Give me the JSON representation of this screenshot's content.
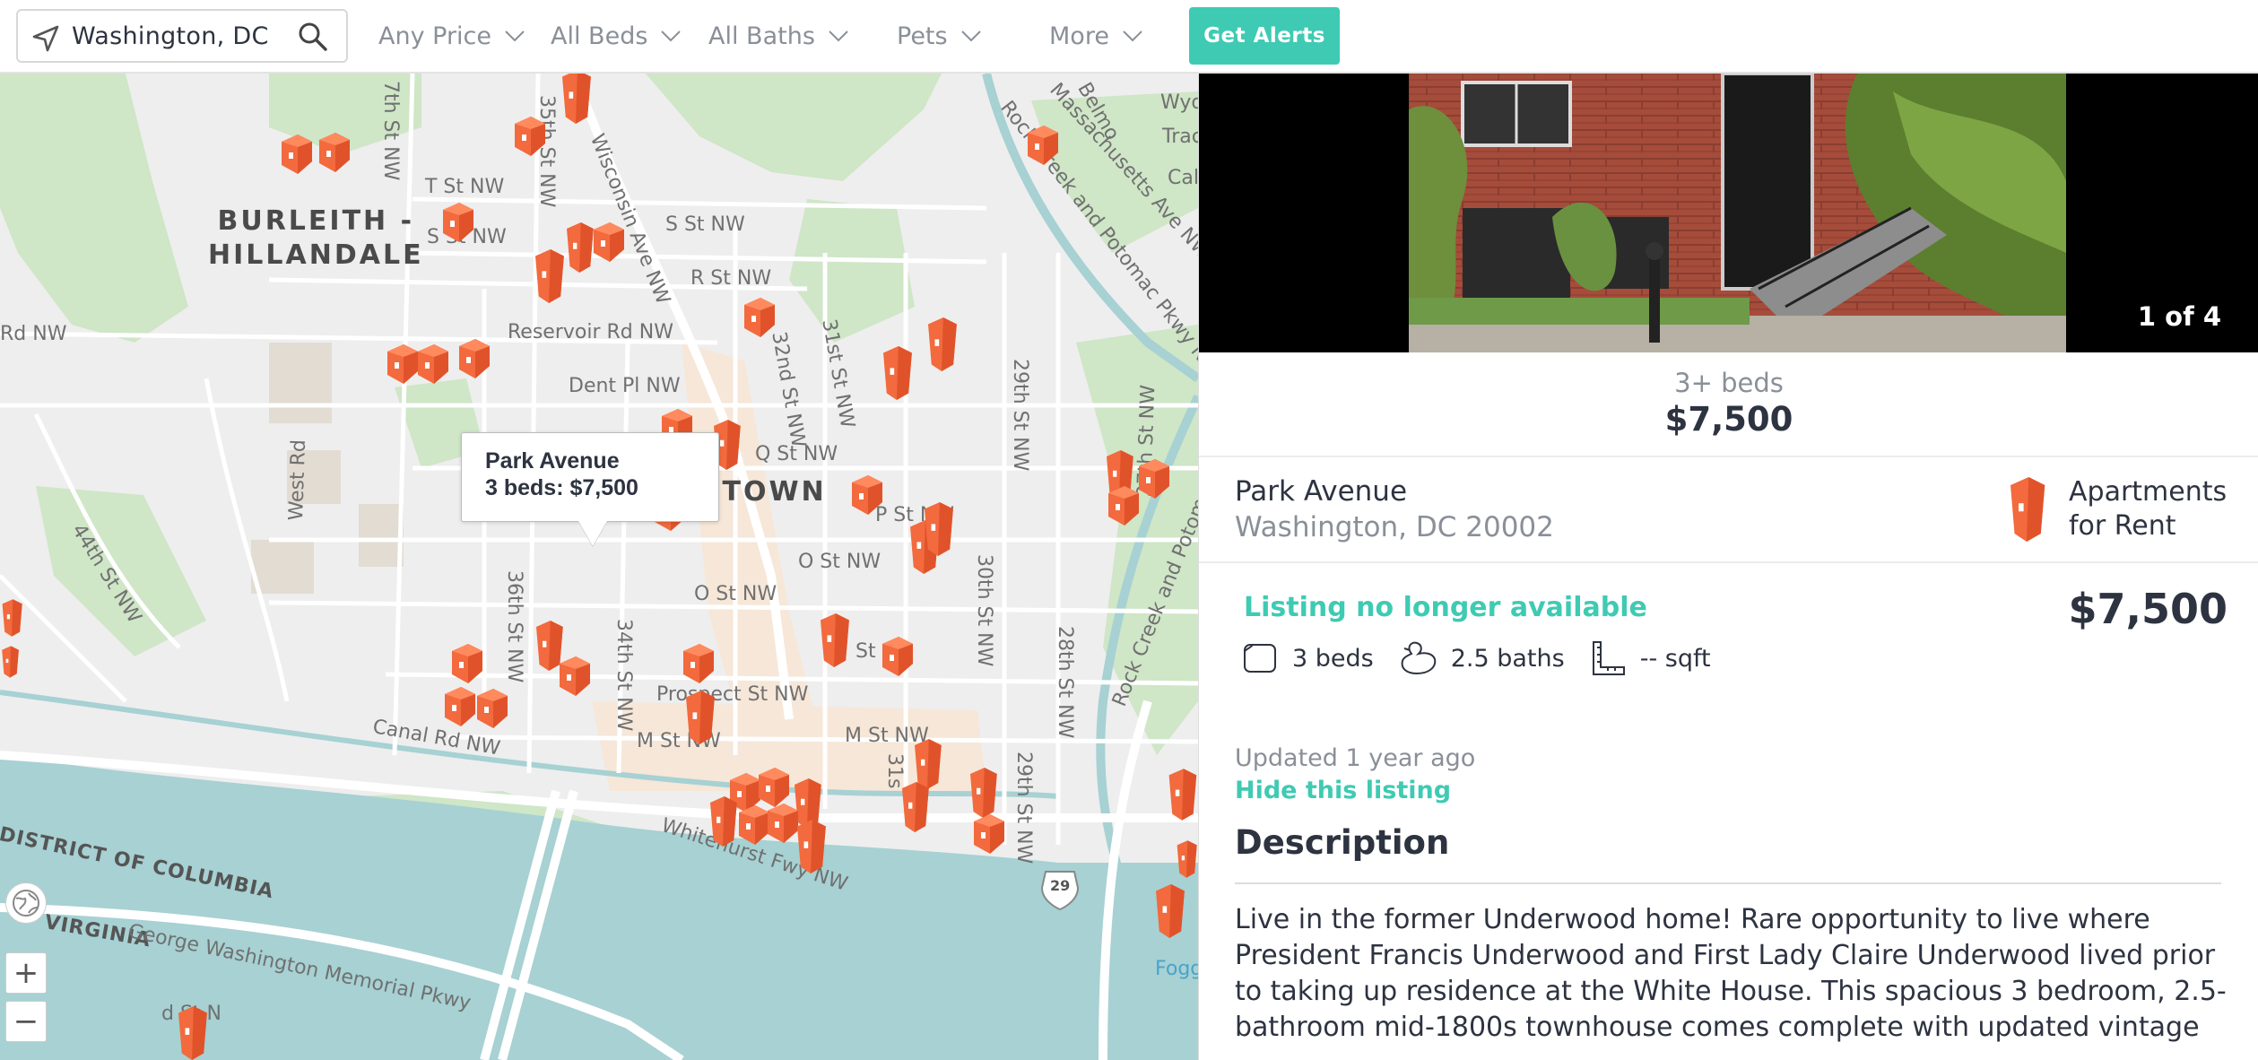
{
  "search": {
    "value": "Washington, DC",
    "icon": "navigation-arrow-icon",
    "submit_icon": "magnifier-icon"
  },
  "filters": [
    {
      "label": "Any Price"
    },
    {
      "label": "All Beds"
    },
    {
      "label": "All Baths"
    },
    {
      "label": "Pets"
    },
    {
      "label": "More"
    }
  ],
  "alerts_label": "Get Alerts",
  "colors": {
    "accent": "#3fcab3",
    "pin": "#f26a3d",
    "water": "#a7d1d3",
    "park": "#cfe6c7"
  },
  "map": {
    "neighborhoods": [
      "BURLEITH -",
      "HILLANDALE",
      "ETOWN"
    ],
    "streets": [
      "7th St NW",
      "35th St NW",
      "Wisconsin Ave NW",
      "T St NW",
      "S St NW",
      "S St NW",
      "R St NW",
      "Reservoir Rd NW",
      "Rd NW",
      "Dent Pl NW",
      "32nd St NW",
      "31st St NW",
      "29th St NW",
      "Q St NW",
      "P St NW",
      "O St NW",
      "O St NW",
      "36th St NW",
      "34th St NW",
      "30th St NW",
      "28th St NW",
      "27th St NW",
      "44th St NW",
      "West Rd",
      "St",
      "Prospect St NW",
      "M St NW",
      "M St NW",
      "Canal Rd NW",
      "Whitehurst Fwy NW",
      "31s",
      "29th St NW",
      "DISTRICT OF COLUMBIA",
      "VIRGINIA",
      "George Washington Memorial Pkwy",
      "d St N",
      "Rock Creek and Potomac Pkwy NW",
      "Massachusetts Ave NW",
      "Belmo",
      "Wyo",
      "Trac",
      "Cal",
      "Rock Creek and Potom"
    ],
    "popup": {
      "title": "Park Avenue",
      "subtitle": "3 beds: $7,500"
    },
    "controls": {
      "globe": "globe-icon",
      "zoom_in": "+",
      "zoom_out": "−"
    },
    "foggy_label": "Fogg",
    "route_shield": "29"
  },
  "listing": {
    "photo_counter": "1 of 4",
    "beds_summary": "3+ beds",
    "price_summary": "$7,500",
    "name": "Park Avenue",
    "city": "Washington, DC 20002",
    "type_line1": "Apartments",
    "type_line2": "for Rent",
    "status": "Listing no longer available",
    "price": "$7,500",
    "beds": "3 beds",
    "baths": "2.5 baths",
    "sqft": "-- sqft",
    "updated": "Updated 1 year ago",
    "hide_label": "Hide this listing",
    "description_heading": "Description",
    "description": "Live in the former Underwood home! Rare opportunity to live where President Francis Underwood and First Lady Claire Underwood lived prior to taking up residence at the White House. This spacious 3 bedroom, 2.5-bathroom mid-1800s townhouse comes complete with updated vintage"
  }
}
